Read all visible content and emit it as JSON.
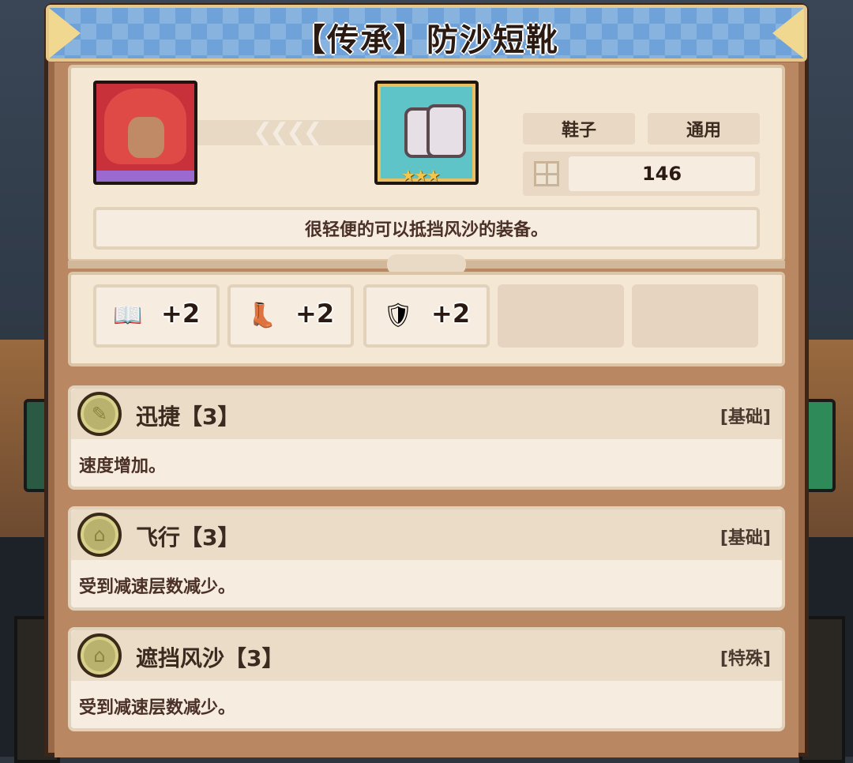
{
  "title": "【传承】防沙短靴",
  "item": {
    "stars": "★★★",
    "tags": [
      "鞋子",
      "通用"
    ],
    "stat_value": "146",
    "description": "很轻便的可以抵挡风沙的装备。",
    "icons": {
      "portrait": "hero-portrait",
      "item": "boots-icon",
      "stat": "grid-icon"
    }
  },
  "attributes": [
    {
      "icon": "book-icon",
      "glyph": "📖",
      "value": "+2"
    },
    {
      "icon": "boot-icon",
      "glyph": "👢",
      "value": "+2"
    },
    {
      "icon": "shield-icon",
      "glyph": "🛡",
      "value": "+2"
    }
  ],
  "skills": [
    {
      "name": "迅捷【3】",
      "type": "[基础]",
      "desc": "速度增加。",
      "icon": "feather-medal-icon"
    },
    {
      "name": "飞行【3】",
      "type": "[基础]",
      "desc": "受到减速层数减少。",
      "icon": "lock-medal-icon"
    },
    {
      "name": "遮挡风沙【3】",
      "type": "[特殊]",
      "desc": "受到减速层数减少。",
      "icon": "lock-medal-icon"
    }
  ],
  "colors": {
    "banner": "#6fa2d8",
    "panel": "#9a6a48",
    "card": "#f4e7d4",
    "medal": "#b9b26e"
  }
}
